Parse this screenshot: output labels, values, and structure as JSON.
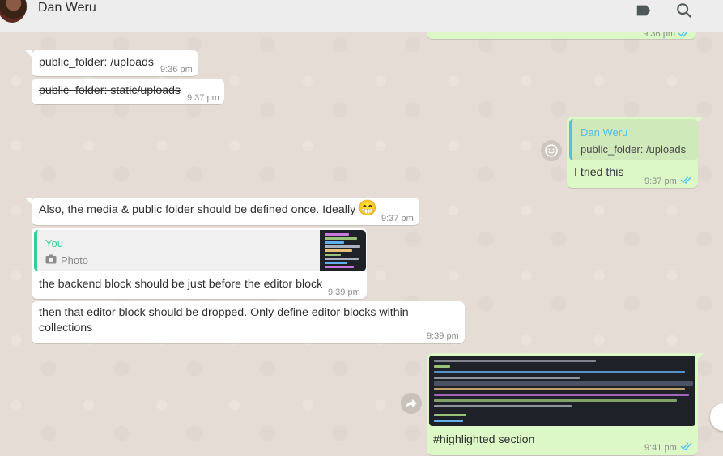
{
  "header": {
    "contact_name": "Dan Weru",
    "tag_icon": "label-icon",
    "search_icon": "search-icon"
  },
  "messages": {
    "top_partial": {
      "time": "9:36 pm"
    },
    "m1": {
      "text": "public_folder: /uploads",
      "time": "9:36 pm"
    },
    "m2": {
      "text": "public_folder: static/uploads",
      "time": "9:37 pm"
    },
    "m3": {
      "quote_author": "Dan Weru",
      "quote_text": "public_folder: /uploads",
      "text": "I tried this",
      "time": "9:37 pm"
    },
    "m4": {
      "text": "Also, the media & public folder should be defined once. Ideally",
      "emoji": "😁",
      "time": "9:37 pm"
    },
    "m5": {
      "quote_author": "You",
      "quote_text": "Photo",
      "text": "the backend block should be just before the editor block",
      "time": "9:39 pm"
    },
    "m6": {
      "line1": "then that editor block should be dropped. Only define editor blocks within",
      "line2": "collections",
      "time": "9:39 pm"
    },
    "m7": {
      "caption": "#highlighted section",
      "time": "9:41 pm"
    }
  },
  "colors": {
    "incoming": "#ffffff",
    "outgoing": "#dcf8c6",
    "read_ticks": "#4fc3f7",
    "quote_you": "#35cd96",
    "quote_other": "#53bdeb"
  }
}
